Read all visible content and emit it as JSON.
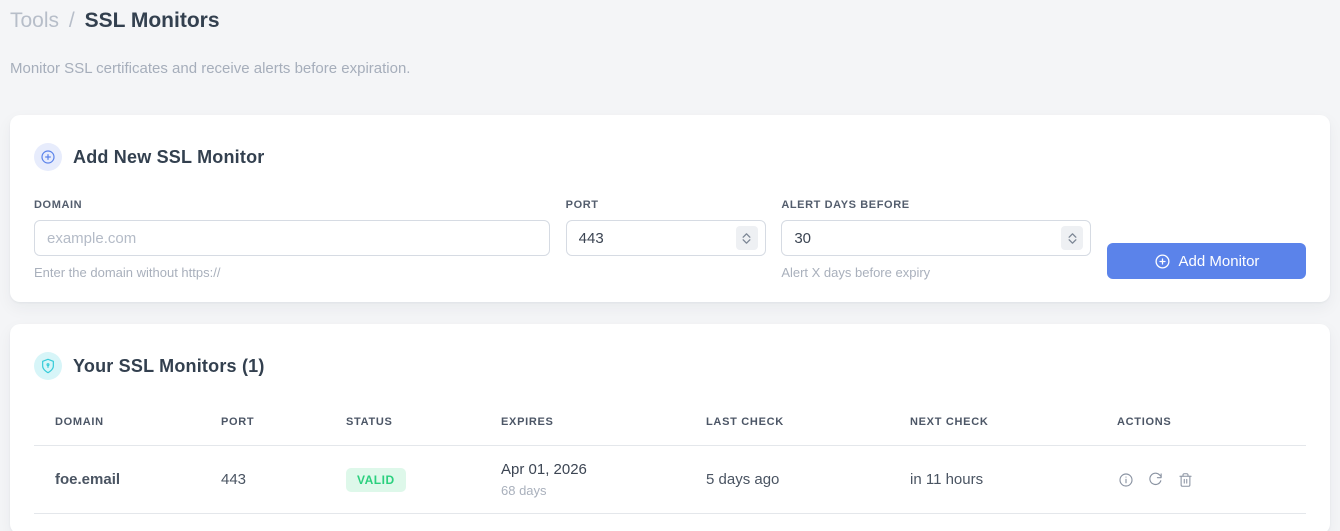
{
  "colors": {
    "accent_blue": "#5b83ea",
    "valid_text": "#2bd07e",
    "valid_background": "#def8ea",
    "shield_cyan": "#35cbd8"
  },
  "breadcrumb": {
    "section": "Tools",
    "separator": "/",
    "current": "SSL Monitors"
  },
  "subtitle": "Monitor SSL certificates and receive alerts before expiration.",
  "add_monitor": {
    "title": "Add New SSL Monitor",
    "fields": {
      "domain": {
        "label": "DOMAIN",
        "placeholder": "example.com",
        "hint": "Enter the domain without https://"
      },
      "port": {
        "label": "PORT",
        "value": "443"
      },
      "alert_days": {
        "label": "ALERT DAYS BEFORE",
        "value": "30",
        "hint": "Alert X days before expiry"
      }
    },
    "submit_label": "Add Monitor"
  },
  "monitors": {
    "title": "Your SSL Monitors (1)",
    "table": {
      "headers": [
        "DOMAIN",
        "PORT",
        "STATUS",
        "EXPIRES",
        "LAST CHECK",
        "NEXT CHECK",
        "ACTIONS"
      ],
      "rows": [
        {
          "domain": "foe.email",
          "port": "443",
          "status": "VALID",
          "expires_date": "Apr 01, 2026",
          "expires_remaining": "68 days",
          "last_check": "5 days ago",
          "next_check": "in 11 hours"
        }
      ]
    }
  }
}
